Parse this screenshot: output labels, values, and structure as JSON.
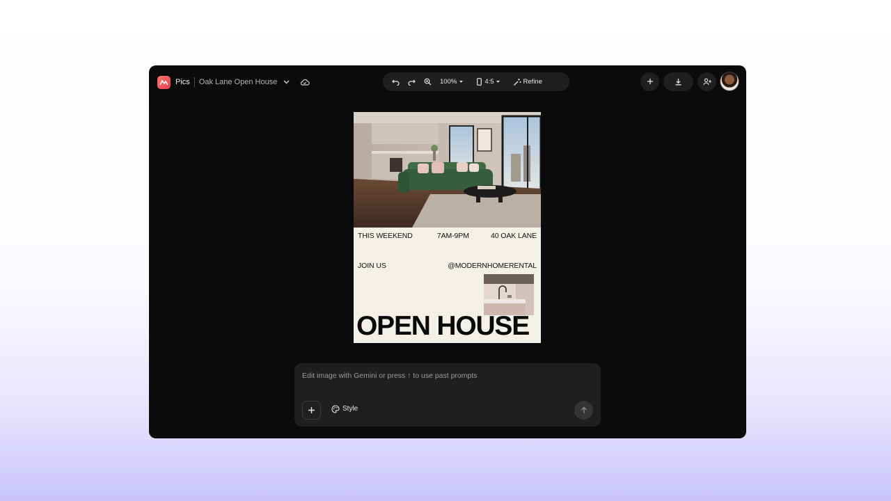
{
  "app": {
    "name": "Pics",
    "document_title": "Oak Lane Open House"
  },
  "toolbar": {
    "zoom": "100%",
    "aspect_ratio": "4:5",
    "refine_label": "Refine"
  },
  "poster": {
    "row1": {
      "left": "THIS WEEKEND",
      "middle": "7AM-9PM",
      "right": "40 OAK LANE"
    },
    "row2": {
      "left": "JOIN US",
      "right": "@MODERNHOMERENTAL"
    },
    "headline": "OPEN HOUSE"
  },
  "prompt": {
    "placeholder": "Edit image with Gemini or press ↑ to use past prompts",
    "style_label": "Style"
  },
  "icons": {
    "logo": "pics-logo-icon",
    "dropdown": "chevron-down-icon",
    "cloud": "cloud-sync-icon",
    "undo": "undo-icon",
    "redo": "redo-icon",
    "zoom": "zoom-in-icon",
    "phone": "phone-frame-icon",
    "refine": "magic-wand-icon",
    "add": "plus-icon",
    "download": "download-icon",
    "share": "add-person-icon",
    "palette": "palette-icon",
    "send": "arrow-up-icon"
  },
  "colors": {
    "app_bg": "#0b0b0b",
    "surface": "#1f1f21",
    "poster_bg": "#f3f0e8",
    "sofa_green": "#3f6b45",
    "logo_accent": "#e23b53"
  }
}
